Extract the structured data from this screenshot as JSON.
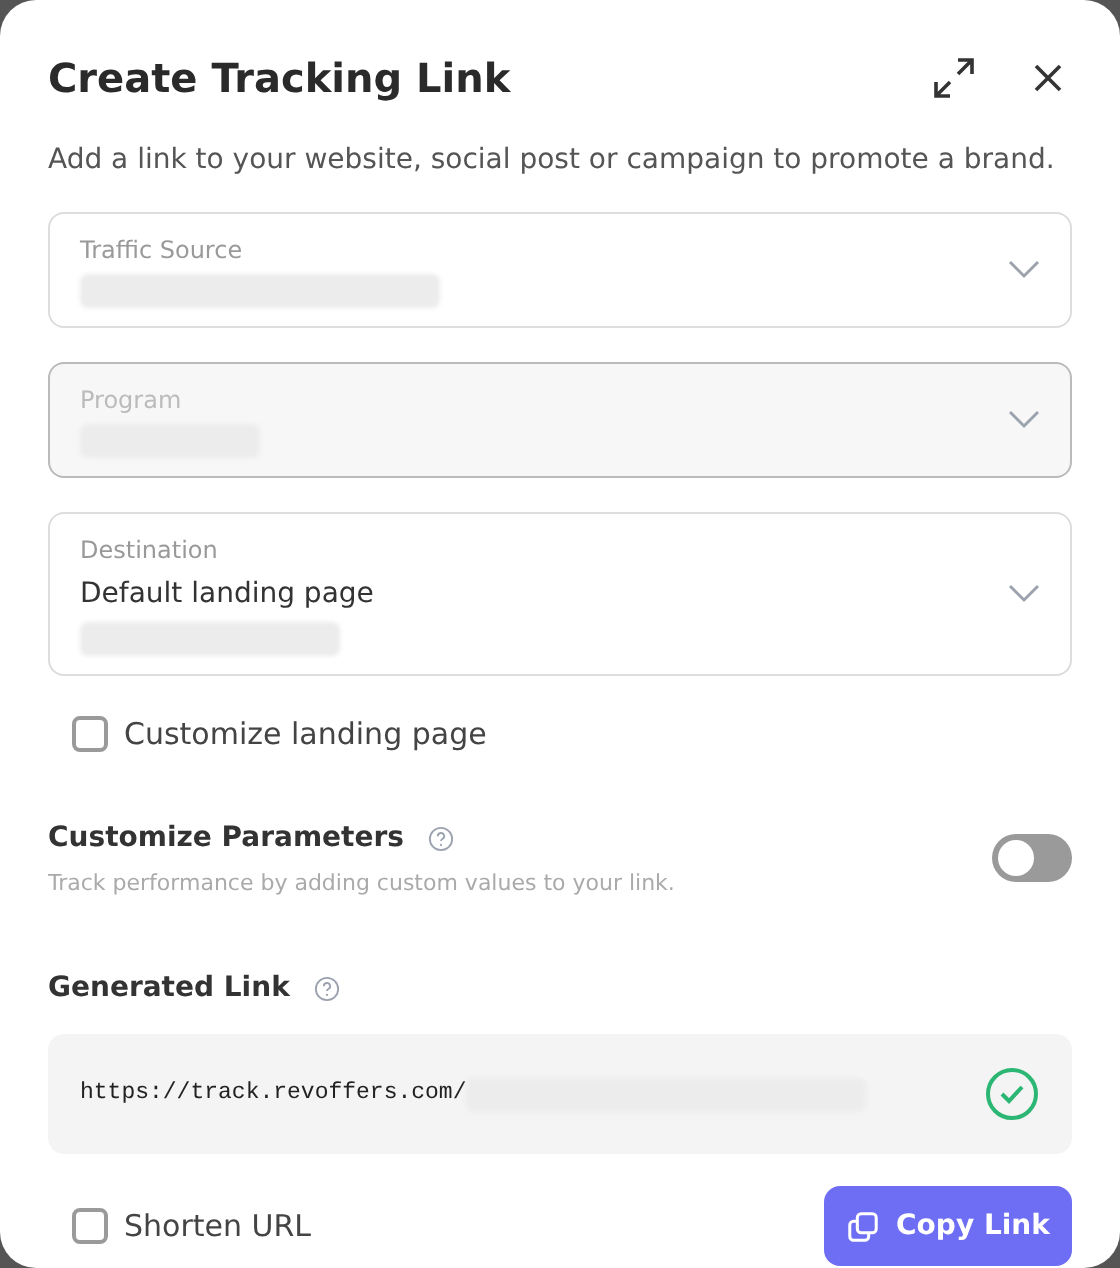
{
  "dialog": {
    "title": "Create Tracking Link",
    "subtitle": "Add a link to your website, social post or campaign to promote a brand."
  },
  "fields": [
    {
      "label": "Traffic Source",
      "disabled": false,
      "value_hidden": true
    },
    {
      "label": "Program",
      "disabled": true,
      "value_hidden": true
    },
    {
      "label": "Destination",
      "value": "Default landing page",
      "disabled": false,
      "value_hidden": true
    }
  ],
  "customize_landing": {
    "label": "Customize landing page",
    "checked": false
  },
  "parameters": {
    "title": "Customize Parameters",
    "description": "Track performance by adding custom values to your link.",
    "on": false
  },
  "generated_link": {
    "title": "Generated Link",
    "url": "https://track.revoffers.com/",
    "url_hidden": true,
    "valid": true
  },
  "shorten_url": {
    "label": "Shorten URL",
    "checked": false
  },
  "copy_button": {
    "label": "Copy Link"
  }
}
